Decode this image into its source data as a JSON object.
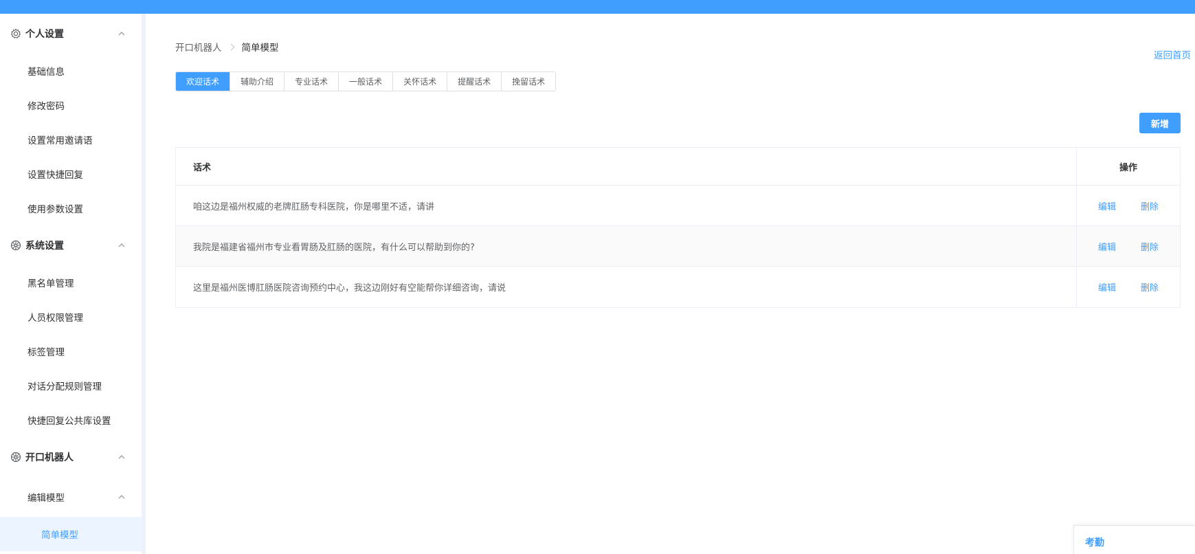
{
  "colors": {
    "primary": "#409eff",
    "sidebar_active_bg": "#ecf5ff",
    "text": "#303133",
    "muted": "#606266",
    "border": "#ebeef5"
  },
  "sidebar": {
    "groups": [
      {
        "label": "个人设置",
        "icon": "gear-icon",
        "items": [
          "基础信息",
          "修改密码",
          "设置常用邀请语",
          "设置快捷回复",
          "使用参数设置"
        ]
      },
      {
        "label": "系统设置",
        "icon": "settings-wheel-icon",
        "items": [
          "黑名单管理",
          "人员权限管理",
          "标签管理",
          "对话分配规则管理",
          "快捷回复公共库设置"
        ]
      },
      {
        "label": "开口机器人",
        "icon": "robot-wheel-icon",
        "submenu": {
          "label": "编辑模型",
          "items": [
            "简单模型"
          ]
        }
      }
    ]
  },
  "breadcrumb": {
    "parent": "开口机器人",
    "current": "简单模型"
  },
  "back_home": "返回首页",
  "tabs": [
    "欢迎话术",
    "辅助介绍",
    "专业话术",
    "一般话术",
    "关怀话术",
    "提醒话术",
    "挽留话术"
  ],
  "active_tab": "欢迎话术",
  "add_button": "新增",
  "table": {
    "headers": {
      "text": "话术",
      "ops": "操作"
    },
    "rows": [
      {
        "text": "咱这边是福州权威的老牌肛肠专科医院，你是哪里不适，请讲"
      },
      {
        "text": "我院是福建省福州市专业看胃肠及肛肠的医院，有什么可以帮助到你的?"
      },
      {
        "text": "这里是福州医博肛肠医院咨询预约中心，我这边刚好有空能帮你详细咨询，请说"
      }
    ],
    "edit_label": "编辑",
    "delete_label": "删除"
  },
  "corner_panel": {
    "title": "考勤"
  }
}
